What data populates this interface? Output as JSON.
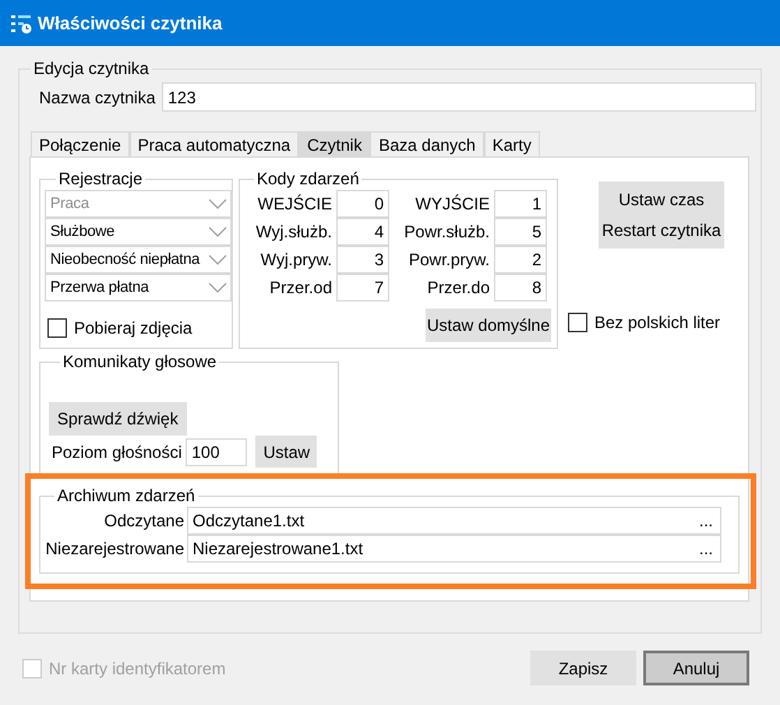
{
  "window": {
    "title": "Właściwości czytnika"
  },
  "reader_edit": {
    "legend": "Edycja czytnika",
    "name_label": "Nazwa czytnika",
    "name_value": "123"
  },
  "tabs": [
    {
      "label": "Połączenie",
      "selected": false
    },
    {
      "label": "Praca automatyczna",
      "selected": false
    },
    {
      "label": "Czytnik",
      "selected": true
    },
    {
      "label": "Baza danych",
      "selected": false
    },
    {
      "label": "Karty",
      "selected": false
    }
  ],
  "registration": {
    "legend": "Rejestracje",
    "combos": [
      {
        "value": "Praca",
        "disabled": true
      },
      {
        "value": "Służbowe",
        "disabled": false
      },
      {
        "value": "Nieobecność niepłatna",
        "disabled": false
      },
      {
        "value": "Przerwa płatna",
        "disabled": false
      }
    ],
    "photo_checkbox": {
      "label": "Pobieraj zdjęcia",
      "checked": false
    }
  },
  "event_codes": {
    "legend": "Kody zdarzeń",
    "left": [
      {
        "label": "WEJŚCIE",
        "value": "0"
      },
      {
        "label": "Wyj.służb.",
        "value": "4"
      },
      {
        "label": "Wyj.pryw.",
        "value": "3"
      },
      {
        "label": "Przer.od",
        "value": "7"
      }
    ],
    "right": [
      {
        "label": "WYJŚCIE",
        "value": "1"
      },
      {
        "label": "Powr.służb.",
        "value": "5"
      },
      {
        "label": "Powr.pryw.",
        "value": "2"
      },
      {
        "label": "Przer.do",
        "value": "8"
      }
    ],
    "default_button": "Ustaw domyślne"
  },
  "reader_buttons": [
    "Ustaw czas",
    "Restart czytnika"
  ],
  "no_polish_checkbox": {
    "label": "Bez polskich liter",
    "checked": false
  },
  "voice": {
    "legend": "Komunikaty głosowe",
    "test_button": "Sprawdź dźwięk",
    "volume_label": "Poziom głośności",
    "volume_value": "100",
    "set_button": "Ustaw"
  },
  "archive": {
    "legend": "Archiwum zdarzeń",
    "highlighted": true,
    "files": [
      {
        "label": "Odczytane",
        "value": "Odczytane1.txt",
        "browse": "..."
      },
      {
        "label": "Niezarejestrowane",
        "value": "Niezarejestrowane1.txt",
        "browse": "..."
      }
    ]
  },
  "card_checkbox": {
    "label": "Nr karty identyfikatorem",
    "checked": false,
    "disabled": true
  },
  "buttons": [
    {
      "label": "Zapisz",
      "default": false
    },
    {
      "label": "Anuluj",
      "default": true
    }
  ]
}
